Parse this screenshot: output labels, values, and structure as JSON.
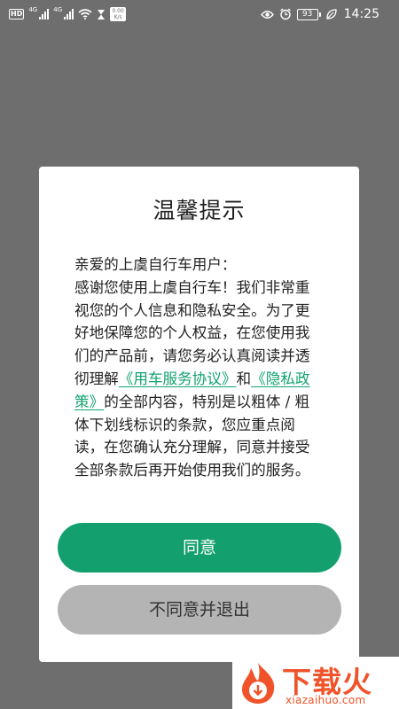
{
  "status_bar": {
    "hd_badge": "HD",
    "network_1": "4G",
    "network_2": "4G",
    "speed_badge": "0.00 K/s",
    "battery": "93",
    "time": "14:25",
    "icons": [
      "hd-icon",
      "signal-icon",
      "signal-icon",
      "wifi-icon",
      "hourglass-icon",
      "speed-icon",
      "eye-icon",
      "alarm-icon",
      "battery-icon",
      "leaf-icon"
    ]
  },
  "dialog": {
    "title": "温馨提示",
    "body": {
      "greeting": "亲爱的上虞自行车用户：",
      "text_before_links": "感谢您使用上虞自行车！我们非常重视您的个人信息和隐私安全。为了更好地保障您的个人权益，在您使用我们的产品前，请您务必认真阅读并透彻理解",
      "link_service": "《用车服务协议》",
      "connector": "和",
      "link_privacy": "《隐私政策》",
      "text_after_links": "的全部内容，特别是以粗体 / 粗体下划线标识的条款，您应重点阅读，在您确认充分理解，同意并接受全部条款后再开始使用我们的服务。"
    },
    "agree_label": "同意",
    "disagree_label": "不同意并退出"
  },
  "watermark": {
    "brand_cn": "下载火",
    "brand_en": "xiazaihuo.com"
  },
  "colors": {
    "accent": "#14a06e",
    "link": "#12a36f",
    "secondary_button": "#b4b4b4",
    "overlay": "#6e6e6e",
    "watermark": "#f0532a"
  }
}
